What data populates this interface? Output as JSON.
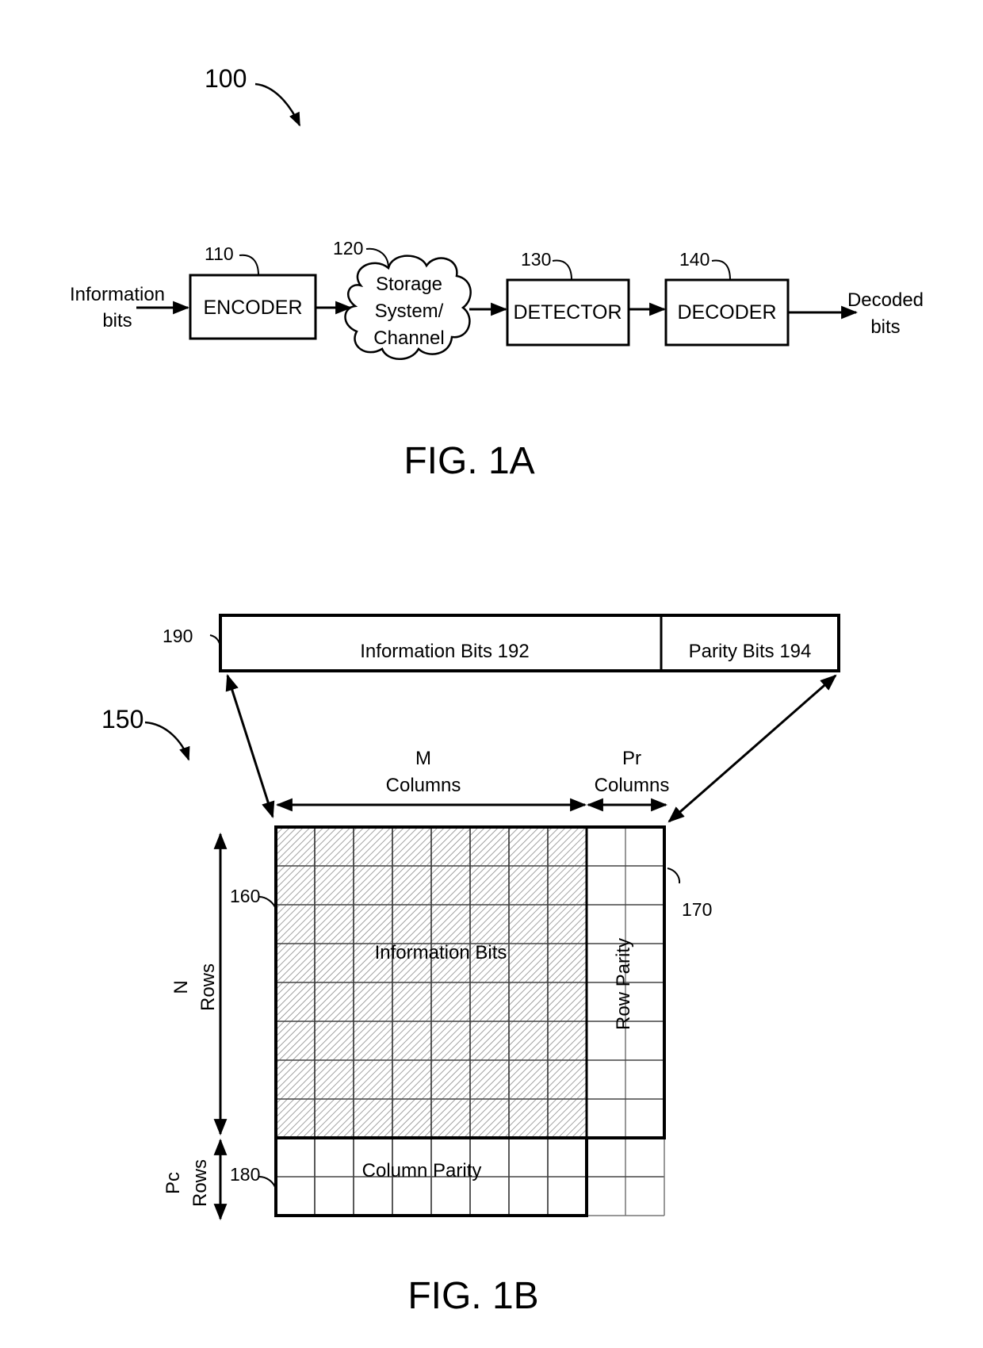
{
  "fig1a": {
    "ref": "100",
    "caption": "FIG. 1A",
    "input_label": [
      "Information",
      "bits"
    ],
    "output_label": [
      "Decoded",
      "bits"
    ],
    "blocks": [
      {
        "ref": "110",
        "label": "ENCODER"
      },
      {
        "ref": "120",
        "label": [
          "Storage",
          "System/",
          "Channel"
        ]
      },
      {
        "ref": "130",
        "label": "DETECTOR"
      },
      {
        "ref": "140",
        "label": "DECODER"
      }
    ]
  },
  "fig1b": {
    "ref": "150",
    "caption": "FIG. 1B",
    "codeword": {
      "ref": "190",
      "info_label": "Information Bits 192",
      "parity_label": "Parity Bits 194"
    },
    "m_columns": [
      "M",
      "Columns"
    ],
    "pr_columns": [
      "Pr",
      "Columns"
    ],
    "n_rows": [
      "N",
      "Rows"
    ],
    "pc_rows": [
      "Pc",
      "Rows"
    ],
    "info_block": {
      "ref": "160",
      "label": "Information Bits"
    },
    "row_parity": {
      "ref": "170",
      "label": "Row Parity"
    },
    "col_parity": {
      "ref": "180",
      "label": "Column Parity"
    },
    "grid": {
      "info_cols": 8,
      "info_rows": 8,
      "parity_cols": 2,
      "parity_rows": 2
    }
  }
}
